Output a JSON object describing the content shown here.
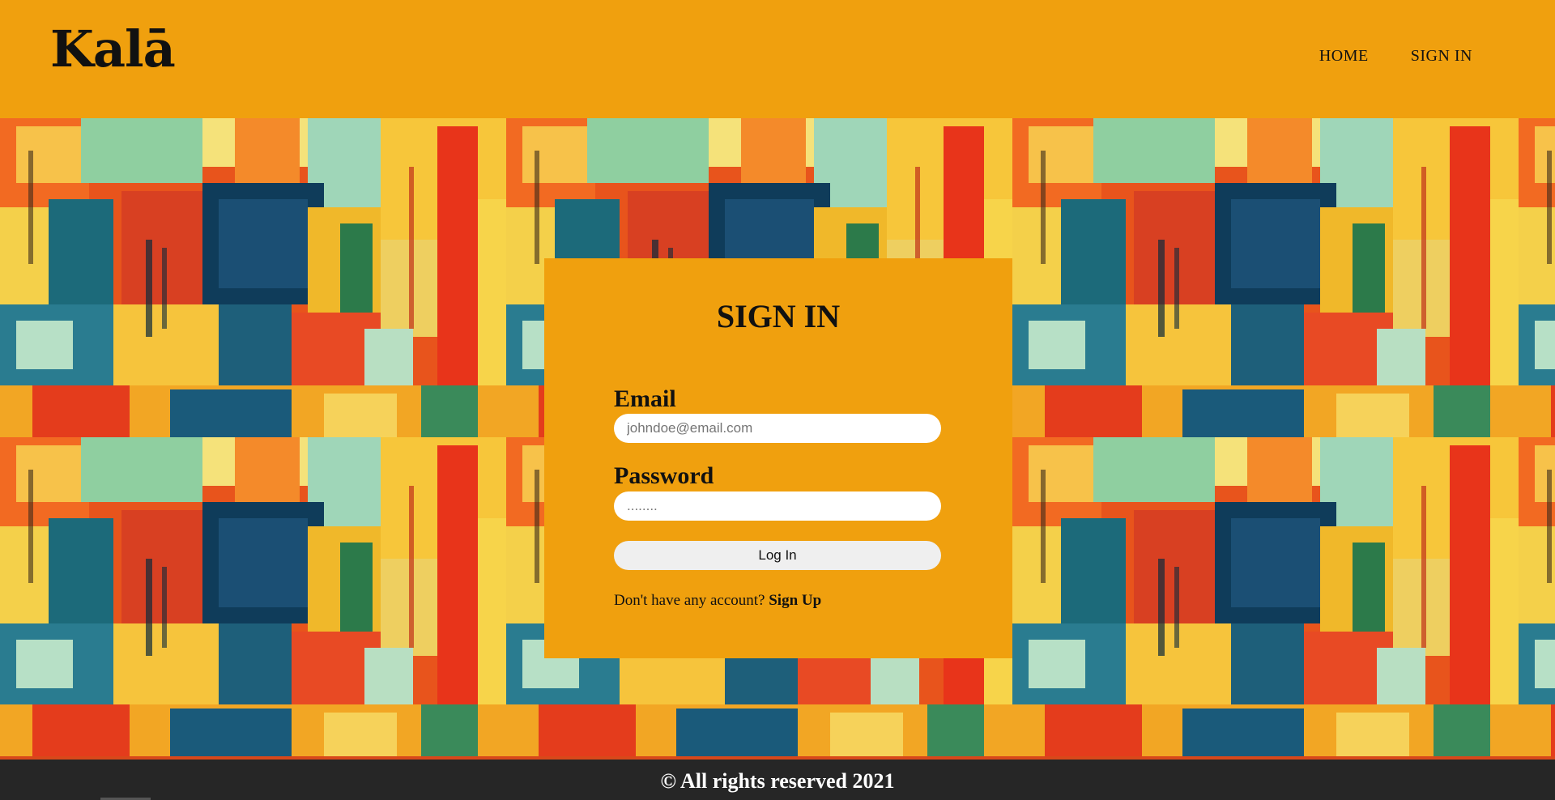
{
  "header": {
    "logo": "Kalā",
    "nav": [
      {
        "label": "HOME"
      },
      {
        "label": "SIGN IN"
      }
    ]
  },
  "signin": {
    "title": "SIGN IN",
    "email_label": "Email",
    "email_placeholder": "johndoe@email.com",
    "password_label": "Password",
    "password_placeholder": "........",
    "login_button": "Log In",
    "no_account_text": "Don't have any account?",
    "signup_link": "Sign Up"
  },
  "footer": {
    "text": "© All rights reserved 2021"
  },
  "colors": {
    "accent": "#f0a00e",
    "footer_bg": "#262626"
  }
}
